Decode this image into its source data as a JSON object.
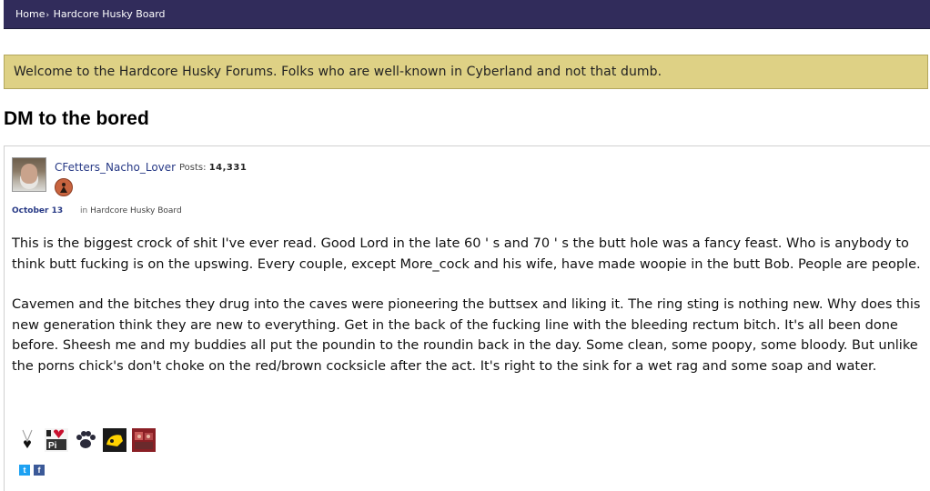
{
  "breadcrumb": {
    "home": "Home",
    "separator": "›",
    "board": "Hardcore Husky Board"
  },
  "announcement": "Welcome to the Hardcore Husky Forums. Folks who are well-known in Cyberland and not that dumb.",
  "thread": {
    "title": "DM to the bored"
  },
  "post": {
    "author": "CFetters_Nacho_Lover",
    "posts_label": "Posts:",
    "posts_count": "14,331",
    "date": "October 13",
    "in_label": "in",
    "category": "Hardcore Husky Board",
    "paragraphs": [
      "This is the biggest crock of shit I've ever read. Good Lord in the late 60 ' s and 70 ' s the butt hole was a fancy feast. Who is anybody to think butt fucking is on the upswing. Every couple, except More_cock and his wife, have made woopie in the butt Bob. People are people.",
      "Cavemen and the bitches they drug into the caves were pioneering the buttsex and liking it. The ring sting is nothing new. Why does this new generation think they are new to everything. Get in the back of the fucking line with the bleeding rectum bitch. It's all been done before. Sheesh me and my buddies all put the poundin to the roundin back in the day. Some clean, some poopy, some bloody. But unlike the porns chick's don't choke on the red/brown cocksicle after the act. It's right to the sink for a wet rag and some soap and water."
    ],
    "social": {
      "twitter_glyph": "t",
      "facebook_glyph": "f"
    }
  },
  "colors": {
    "topbar": "#312c5b",
    "announcement_bg": "#ded185",
    "link": "#283a86"
  }
}
